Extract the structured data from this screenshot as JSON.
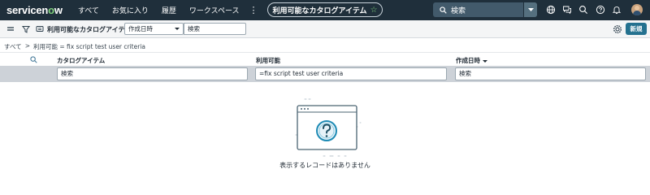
{
  "nav": {
    "logo_main": "servicen",
    "logo_o": "o",
    "logo_tail": "w",
    "links": [
      "すべて",
      "お気に入り",
      "履歴",
      "ワークスペース"
    ],
    "more": "⋮",
    "context_pill": "利用可能なカタログアイテム",
    "context_star": "☆",
    "global_search_placeholder": "検索"
  },
  "toolbar": {
    "title": "利用可能なカタログアイテム",
    "field_select": "作成日時",
    "search_placeholder": "検索",
    "new_button": "新規"
  },
  "breadcrumb": {
    "root": "すべて",
    "sep": ">",
    "filter": "利用可能 = fix script test user criteria"
  },
  "table": {
    "columns": [
      {
        "label": "カタログアイテム",
        "sorted": false
      },
      {
        "label": "利用可能",
        "sorted": false
      },
      {
        "label": "作成日時",
        "sorted": true
      }
    ],
    "filters": [
      {
        "value": "検索"
      },
      {
        "value": "=fix script test user criteria"
      },
      {
        "value": "検索"
      }
    ]
  },
  "empty_state": {
    "icon": "question-mark-icon",
    "message": "表示するレコードはありません"
  },
  "colors": {
    "nav_bg": "#1f2f3b",
    "accent_green": "#7fd17c",
    "primary_button": "#24718f",
    "filter_row_bg": "#cdd2d8"
  }
}
